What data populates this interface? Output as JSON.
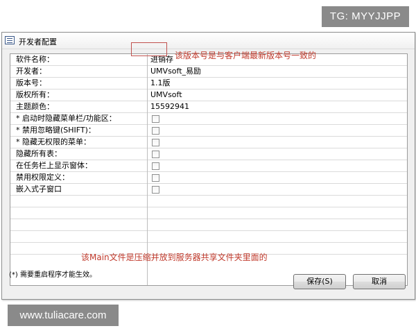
{
  "window": {
    "title": "开发者配置"
  },
  "settings": {
    "rows": [
      {
        "label": "软件名称：",
        "value": "进销存"
      },
      {
        "label": "开发者：",
        "value": "UMVsoft_易励"
      },
      {
        "label": "版本号：",
        "value": "1.1版"
      },
      {
        "label": "版权所有：",
        "value": "UMVsoft"
      },
      {
        "label": "主题颜色：",
        "value": "15592941"
      },
      {
        "label": "* 启动时隐藏菜单栏/功能区：",
        "checked": false
      },
      {
        "label": "* 禁用忽略键(SHIFT)：",
        "checked": false
      },
      {
        "label": "* 隐藏无权限的菜单：",
        "checked": false
      },
      {
        "label": "隐藏所有表：",
        "checked": false
      },
      {
        "label": "在任务栏上显示窗体：",
        "checked": false
      },
      {
        "label": "禁用权限定义：",
        "checked": false
      },
      {
        "label": "嵌入式子窗口",
        "checked": false
      },
      {
        "label": ""
      },
      {
        "label": ""
      },
      {
        "label": ""
      },
      {
        "label": ""
      },
      {
        "label": ""
      }
    ]
  },
  "annotations": {
    "version_note": "该版本号是与客户端最新版本号一致的",
    "main_note": "该Main文件是压缩并放到服务器共享文件夹里面的"
  },
  "footer": {
    "note": "(*) 需要重启程序才能生效。",
    "save_label": "保存(S)",
    "cancel_label": "取消"
  },
  "watermarks": {
    "top": "TG: MYYJJPP",
    "bottom": "www.tuliacare.com"
  },
  "colors": {
    "annotation": "#c0392b",
    "highlight_border": "#c0504d"
  }
}
